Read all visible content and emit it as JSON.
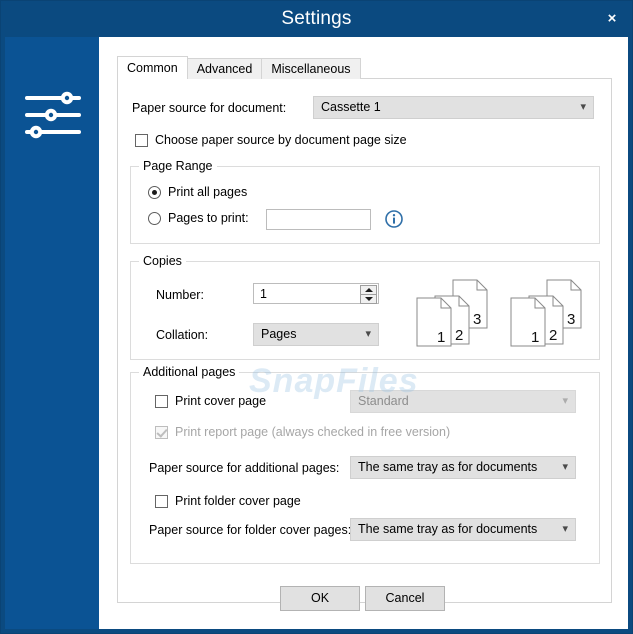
{
  "window": {
    "title": "Settings",
    "close_label": "×",
    "accent_titlebar": "#0b4a80",
    "accent_sidebar": "#0b5394"
  },
  "sidebar": {
    "icon": "sliders-icon"
  },
  "tabs": [
    {
      "label": "Common",
      "active": true
    },
    {
      "label": "Advanced",
      "active": false
    },
    {
      "label": "Miscellaneous",
      "active": false
    }
  ],
  "common": {
    "paper_source_label": "Paper source for document:",
    "paper_source_value": "Cassette 1",
    "choose_by_page_size_label": "Choose paper source by document page size",
    "choose_by_page_size_checked": false,
    "page_range": {
      "title": "Page Range",
      "print_all_label": "Print all pages",
      "print_all_selected": true,
      "pages_to_print_label": "Pages to print:",
      "pages_to_print_selected": false,
      "pages_to_print_value": "",
      "info_icon": "info-icon"
    },
    "copies": {
      "title": "Copies",
      "number_label": "Number:",
      "number_value": "1",
      "collation_label": "Collation:",
      "collation_value": "Pages",
      "preview_page_numbers": [
        "3",
        "2",
        "1"
      ]
    },
    "additional_pages": {
      "title": "Additional pages",
      "print_cover_label": "Print cover page",
      "print_cover_checked": false,
      "cover_style_value": "Standard",
      "cover_style_disabled": true,
      "print_report_label": "Print report page (always checked in free version)",
      "print_report_checked": true,
      "print_report_disabled": true,
      "additional_source_label": "Paper source for additional pages:",
      "additional_source_value": "The same tray as for documents",
      "print_folder_cover_label": "Print folder cover page",
      "print_folder_cover_checked": false,
      "folder_source_label": "Paper source for folder cover pages:",
      "folder_source_value": "The same tray as for documents"
    }
  },
  "footer": {
    "ok_label": "OK",
    "cancel_label": "Cancel"
  },
  "watermark": {
    "text": "SnapFiles"
  }
}
